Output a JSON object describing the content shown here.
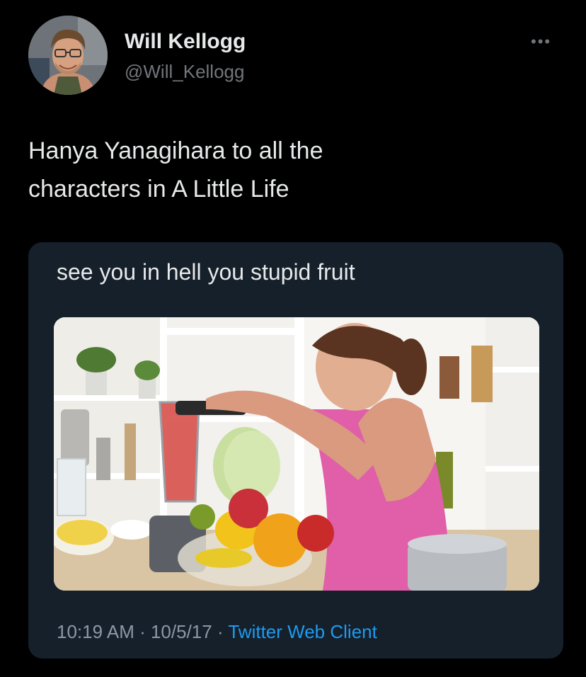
{
  "author": {
    "display_name": "Will Kellogg",
    "handle": "@Will_Kellogg",
    "avatar_icon": "user-avatar-photo"
  },
  "more_icon": "ellipsis-icon",
  "tweet": {
    "text": "Hanya Yanagihara to all the\ncharacters in A Little Life"
  },
  "quoted_card": {
    "text": "see you in hell you stupid fruit",
    "image_subject": "woman-blending-fruit-photo"
  },
  "meta": {
    "time": "10:19 AM",
    "separator1": " · ",
    "date": "10/5/17",
    "separator2": " · ",
    "client": "Twitter Web Client"
  },
  "colors": {
    "background": "#000000",
    "card_background": "#15202b",
    "text_primary": "#e7e9ea",
    "text_secondary": "#71767b",
    "link": "#1d9bf0"
  }
}
